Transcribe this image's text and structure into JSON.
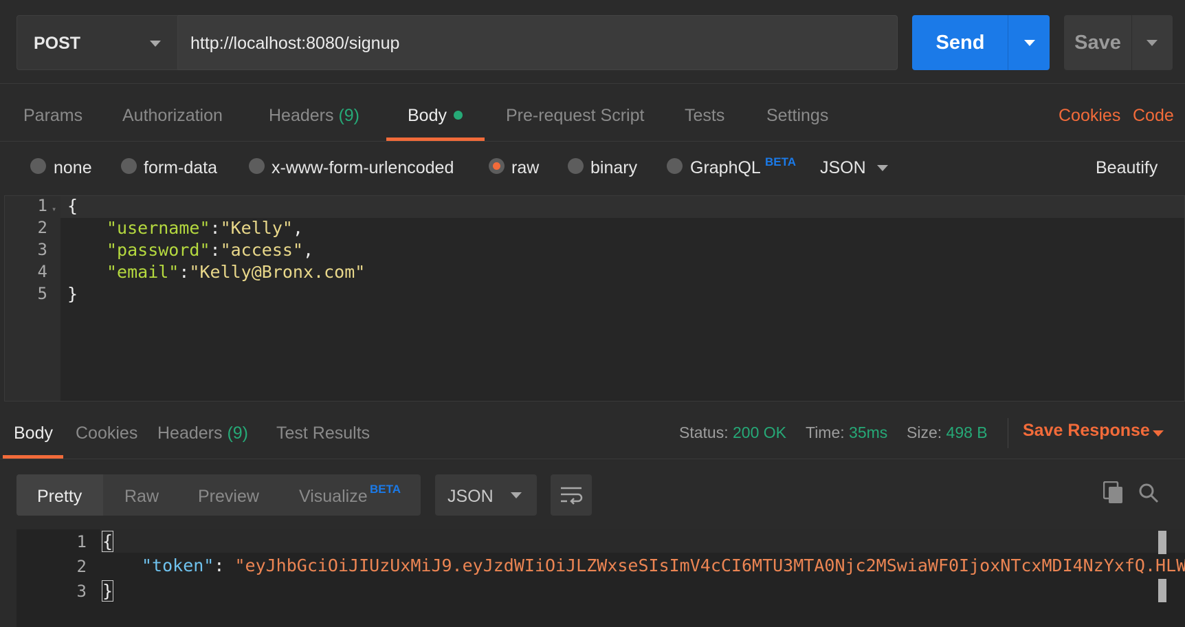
{
  "request": {
    "method": "POST",
    "url": "http://localhost:8080/signup",
    "send_label": "Send",
    "save_label": "Save"
  },
  "request_tabs": {
    "params": "Params",
    "authorization": "Authorization",
    "headers": "Headers",
    "headers_count": "(9)",
    "body": "Body",
    "prerequest": "Pre-request Script",
    "tests": "Tests",
    "settings": "Settings",
    "cookies": "Cookies",
    "code": "Code"
  },
  "body_options": {
    "none": "none",
    "form_data": "form-data",
    "urlencoded": "x-www-form-urlencoded",
    "raw": "raw",
    "binary": "binary",
    "graphql": "GraphQL",
    "beta": "BETA",
    "format": "JSON",
    "beautify": "Beautify",
    "selected": "raw"
  },
  "editor": {
    "line_numbers": [
      "1",
      "2",
      "3",
      "4",
      "5"
    ],
    "open_brace": "{",
    "close_brace": "}",
    "fields": [
      {
        "key": "\"username\"",
        "value": "\"Kelly\"",
        "sep": ":",
        "trail": ","
      },
      {
        "key": "\"password\"",
        "value": "\"access\"",
        "sep": ":",
        "trail": ","
      },
      {
        "key": "\"email\"",
        "value": "\"Kelly@Bronx.com\"",
        "sep": ":",
        "trail": ""
      }
    ]
  },
  "response_tabs": {
    "body": "Body",
    "cookies": "Cookies",
    "headers": "Headers",
    "headers_count": "(9)",
    "test_results": "Test Results"
  },
  "status": {
    "status_label": "Status:",
    "status_value": "200 OK",
    "time_label": "Time:",
    "time_value": "35ms",
    "size_label": "Size:",
    "size_value": "498 B",
    "save_response": "Save Response"
  },
  "view": {
    "pretty": "Pretty",
    "raw": "Raw",
    "preview": "Preview",
    "visualize": "Visualize",
    "beta": "BETA",
    "format": "JSON"
  },
  "response": {
    "line_numbers": [
      "1",
      "2",
      "3"
    ],
    "open_brace": "{",
    "close_brace": "}",
    "key": "\"token\"",
    "sep": ": ",
    "value": "\"eyJhbGciOiJIUzUxMiJ9.eyJzdWIiOiJLZWxseSIsImV4cCI6MTU3MTA0Njc2MSwiaWF0IjoxNTcxMDI4NzYxfQ.HLWbGz"
  },
  "colors": {
    "accent": "#f26b3a",
    "send": "#1b7ae8",
    "success": "#26a977"
  }
}
